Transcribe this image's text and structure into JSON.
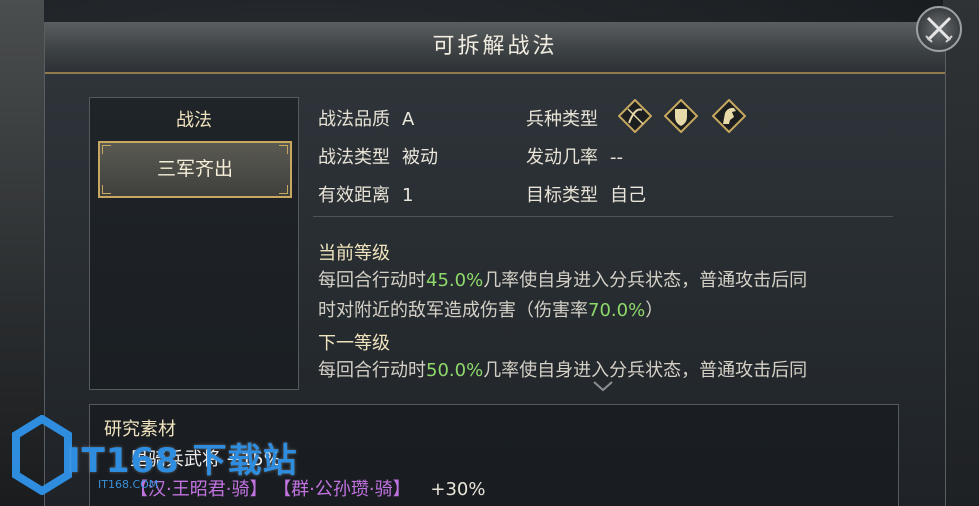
{
  "dialog": {
    "title": "可拆解战法"
  },
  "skill_list": {
    "title": "战法",
    "items": [
      {
        "label": "三军齐出",
        "selected": true
      }
    ]
  },
  "attributes": {
    "quality_label": "战法品质",
    "quality_value": "A",
    "type_label": "战法类型",
    "type_value": "被动",
    "range_label": "有效距离",
    "range_value": "1",
    "troop_label": "兵种类型",
    "troop_icons": [
      "archer-icon",
      "shield-icon",
      "cavalry-icon"
    ],
    "rate_label": "发动几率",
    "rate_value": "--",
    "target_label": "目标类型",
    "target_value": "自己"
  },
  "current_level": {
    "title": "当前等级",
    "line1_a": "每回合行动时",
    "line1_hl": "45.0%",
    "line1_b": "几率使自身进入分兵状态，普通攻击后同",
    "line2_a": "时对附近的敌军造成伤害（伤害率",
    "line2_hl": "70.0%",
    "line2_b": "）"
  },
  "next_level": {
    "title": "下一等级",
    "line1_a": "每回合行动时",
    "line1_hl": "50.0%",
    "line1_b": "几率使自身进入分兵状态，普通攻击后同"
  },
  "materials": {
    "title": "研究素材",
    "row1_text": "里骑兵武将 +15%",
    "row2_tag1": "【汉·王昭君·骑】",
    "row2_tag2": "【群·公孙瓒·骑】",
    "row2_bonus": "+30%"
  },
  "watermark": {
    "text": "IT168 下载站",
    "sub": "IT168.COM"
  },
  "colors": {
    "accent_gold": "#c8a860",
    "highlight_green": "#8ed96a",
    "tag_purple": "#c173e0"
  }
}
